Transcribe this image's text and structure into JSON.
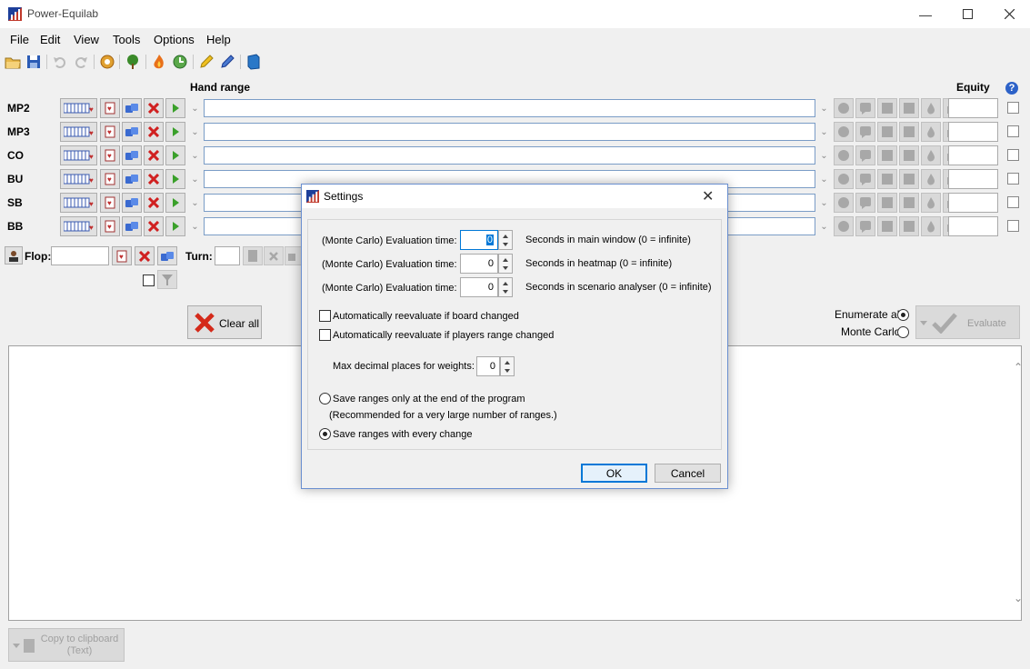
{
  "window": {
    "title": "Power-Equilab"
  },
  "menu": [
    "File",
    "Edit",
    "View",
    "Tools",
    "Options",
    "Help"
  ],
  "toolbar_icons": [
    "open-folder-icon",
    "save-icon",
    "undo-icon",
    "redo-icon",
    "settings-gear-icon",
    "tree-icon",
    "fire-icon",
    "refresh-icon",
    "pencil-yellow-icon",
    "pencil-blue-icon",
    "book-icon"
  ],
  "headers": {
    "hand_range": "Hand range",
    "equity": "Equity"
  },
  "players": [
    {
      "name": "MP2",
      "range": "",
      "equity": ""
    },
    {
      "name": "MP3",
      "range": "",
      "equity": ""
    },
    {
      "name": "CO",
      "range": "",
      "equity": ""
    },
    {
      "name": "BU",
      "range": "",
      "equity": ""
    },
    {
      "name": "SB",
      "range": "",
      "equity": ""
    },
    {
      "name": "BB",
      "range": "",
      "equity": ""
    }
  ],
  "board": {
    "flop_label": "Flop:",
    "flop_value": "",
    "turn_label": "Turn:",
    "turn_value": ""
  },
  "actions": {
    "clear_all": "Clear all",
    "enumerate_all": "Enumerate all",
    "monte_carlo": "Monte Carlo",
    "evaluate": "Evaluate",
    "copy": "Copy to clipboard",
    "copy_sub": "(Text)"
  },
  "settings": {
    "title": "Settings",
    "eval_rows": [
      {
        "label": "(Monte Carlo) Evaluation time:",
        "value": "0",
        "desc": "Seconds in main window (0 = infinite)"
      },
      {
        "label": "(Monte Carlo) Evaluation time:",
        "value": "0",
        "desc": "Seconds in heatmap (0 = infinite)"
      },
      {
        "label": "(Monte Carlo) Evaluation time:",
        "value": "0",
        "desc": "Seconds in scenario analyser (0 = infinite)"
      }
    ],
    "auto_board": "Automatically reevaluate if board changed",
    "auto_range": "Automatically reevaluate if players range changed",
    "decimal_label": "Max decimal places for weights:",
    "decimal_value": "0",
    "save_end": "Save ranges only at the end of the program",
    "save_end_note": "(Recommended for a very large number of ranges.)",
    "save_every": "Save ranges with every change",
    "ok": "OK",
    "cancel": "Cancel"
  }
}
